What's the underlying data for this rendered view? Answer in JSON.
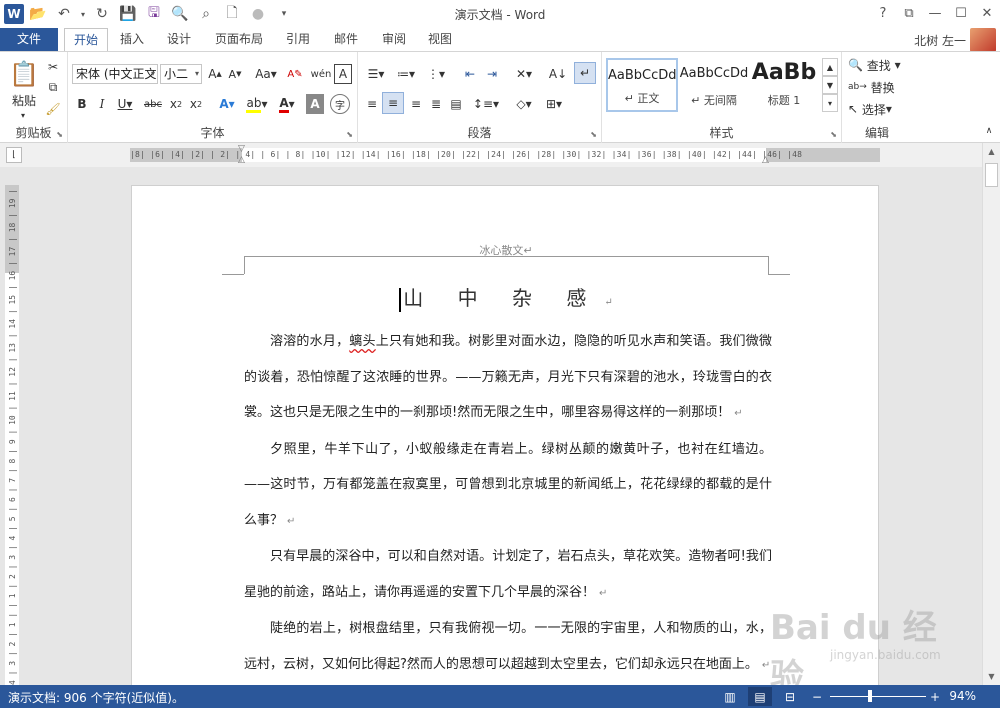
{
  "app": {
    "window_title": "演示文档 - Word",
    "user": "北树 左一"
  },
  "tabs": [
    {
      "label": "文件"
    },
    {
      "label": "开始"
    },
    {
      "label": "插入"
    },
    {
      "label": "设计"
    },
    {
      "label": "页面布局"
    },
    {
      "label": "引用"
    },
    {
      "label": "邮件"
    },
    {
      "label": "审阅"
    },
    {
      "label": "视图"
    }
  ],
  "ribbon": {
    "clipboard": {
      "label": "剪贴板",
      "paste_label": "粘贴"
    },
    "font": {
      "label": "字体",
      "font_name": "宋体 (中文正文",
      "font_size": "小二"
    },
    "paragraph": {
      "label": "段落"
    },
    "styles": {
      "label": "样式",
      "items": [
        {
          "preview": "AaBbCcDd",
          "name": "↵ 正文"
        },
        {
          "preview": "AaBbCcDd",
          "name": "↵ 无间隔"
        },
        {
          "preview": "AaBb",
          "name": "标题 1"
        }
      ]
    },
    "editing": {
      "label": "编辑",
      "find": "查找",
      "replace": "替换",
      "select": "选择"
    }
  },
  "ruler": {
    "horizontal": "|8|  |6|  |4|  |2|  | 2|  | 4|  | 6|  | 8|  |10|  |12|  |14|  |16|  |18|  |20|  |22|  |24|  |26|  |28|  |30|  |32|  |34|  |36|  |38|  |40|  |42|  |44|  |46|  |48",
    "vertical": "4 | 3 | 2 | 1 |  | 1 | 2 | 3 | 4 | 5 | 6 | 7 | 8 | 9 | 10 | 11 | 12 | 13 | 14 | 15 | 16 | 17 | 18 | 19 | 20 | 21"
  },
  "document": {
    "header": "冰心散文↵",
    "title": "山 中 杂 感",
    "paragraphs": [
      {
        "before": "溶溶的水月，",
        "squiggle": "螭头",
        "after": "上只有她和我。树影里对面水边，隐隐的听见水声和笑语。我们微微的谈着，恐怕惊醒了这浓睡的世界。——万籁无声，月光下只有深碧的池水，玲珑雪白的衣裳。这也只是无限之生中的一刹那顷!然而无限之生中，哪里容易得这样的一刹那顷！"
      },
      {
        "before": "夕照里，牛羊下山了，小蚁般缘走在青岩上。绿树丛颠的嫩黄叶子，也衬在红墙边。——这时节，万有都笼盖在寂寞里，可曾想到北京城里的新闻纸上，花花绿绿的都载的是什么事？",
        "squiggle": "",
        "after": ""
      },
      {
        "before": "只有早晨的深谷中，可以和自然对语。计划定了，岩石点头，草花欢笑。造物者呵!我们星驰的前途，路站上，请你再遥遥的安置下几个早晨的深谷！",
        "squiggle": "",
        "after": ""
      },
      {
        "before": "陡绝的岩上，树根盘结里，只有我俯视一切。一一无限的宇宙里，人和物质的山，水，远村，云树，又如何比得起?然而人的思想可以超越到太空里去，它们却永远只在地面上。",
        "squiggle": "",
        "after": ""
      }
    ]
  },
  "statusbar": {
    "info": "演示文档: 906 个字符(近似值)。",
    "zoom": "94%",
    "zoom_level": 0.47
  },
  "watermark": {
    "main": "Bai du 经验",
    "sub": "jingyan.baidu.com"
  },
  "colors": {
    "accent": "#2b579a",
    "font_color": "#e00000",
    "highlight": "#ffff00"
  }
}
